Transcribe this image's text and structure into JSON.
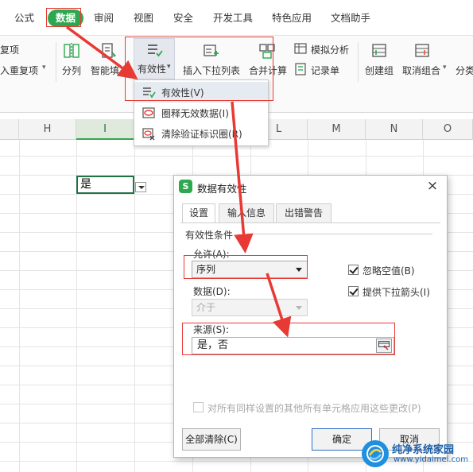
{
  "menubar": {
    "tabs": [
      "公式",
      "数据",
      "审阅",
      "视图",
      "安全",
      "开发工具",
      "特色应用",
      "文档助手"
    ],
    "active": "数据"
  },
  "ribbon": {
    "left_items": [
      "复项",
      "入重复项"
    ],
    "buttons": [
      "分列",
      "智能填充",
      "有效性",
      "插入下拉列表",
      "合并计算",
      "创建组",
      "取消组合",
      "分类"
    ],
    "small_buttons": [
      "模拟分析",
      "记录单"
    ]
  },
  "validity_menu": {
    "items": [
      "有效性(V)",
      "圈释无效数据(I)",
      "清除验证标识圈(R)"
    ]
  },
  "sheet": {
    "columns": [
      "H",
      "I",
      "J",
      "K",
      "L",
      "M",
      "N",
      "O"
    ],
    "selected_column": "I",
    "active_cell_value": "是"
  },
  "dialog": {
    "title": "数据有效性",
    "close_symbol": "×",
    "tabs": [
      "设置",
      "输入信息",
      "出错警告"
    ],
    "section_title": "有效性条件",
    "allow_label": "允许(A):",
    "allow_value": "序列",
    "ignore_blank_label": "忽略空值(B)",
    "ignore_blank_checked": true,
    "dropdown_arrow_label": "提供下拉箭头(I)",
    "dropdown_arrow_checked": true,
    "data_label": "数据(D):",
    "data_value": "介于",
    "source_label": "来源(S):",
    "source_value": "是，否",
    "apply_all_label": "对所有同样设置的其他所有单元格应用这些更改(P)",
    "apply_all_checked": false,
    "clear_all_button": "全部清除(C)",
    "ok_button": "确定",
    "cancel_button": "取消"
  },
  "watermark": {
    "name": "纯净系统家园",
    "url": "www.yidaimei.com"
  },
  "colors": {
    "accent_green": "#2ea84f",
    "annotation_red": "#e83a35",
    "primary_border": "#2f6fc2"
  }
}
